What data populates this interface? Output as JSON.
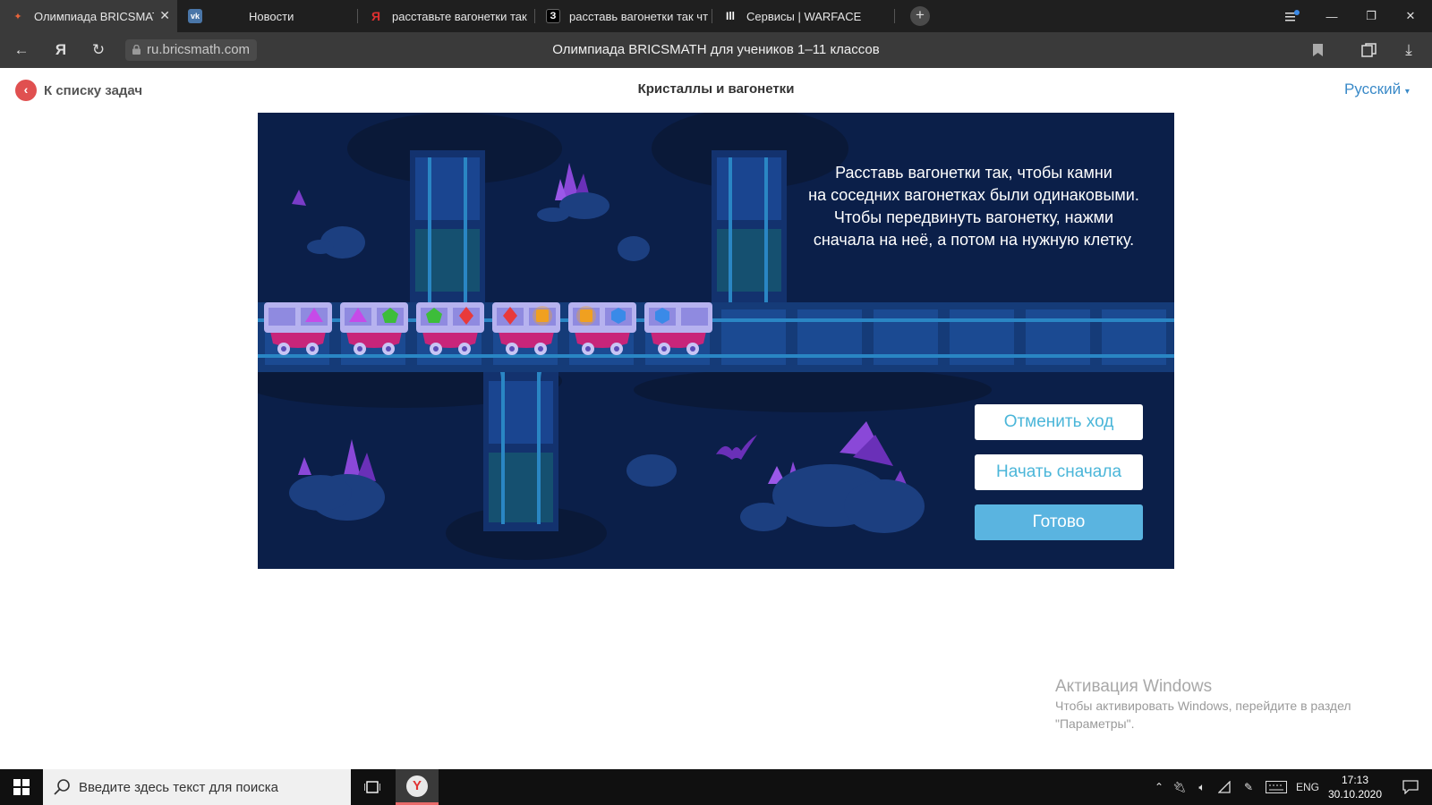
{
  "browser": {
    "tabs": [
      {
        "label": "Олимпиада BRICSMATH",
        "icon": "bricsmath-icon",
        "active": true
      },
      {
        "label": "Новости",
        "icon": "vk-icon",
        "active": false
      },
      {
        "label": "расставьте вагонетки так",
        "icon": "yandex-icon",
        "active": false
      },
      {
        "label": "расставь вагонетки так чт",
        "icon": "znanija-icon",
        "active": false
      },
      {
        "label": "Сервисы | WARFACE",
        "icon": "warface-icon",
        "active": false
      }
    ],
    "url": "ru.bricsmath.com",
    "page_title": "Олимпиада BRICSMATH для учеников 1–11 классов"
  },
  "header": {
    "back_label": "К списку задач",
    "task_title": "Кристаллы и вагонетки",
    "language": "Русский"
  },
  "game": {
    "instructions": [
      "Расставь вагонетки так, чтобы камни",
      "на соседних вагонетках были одинаковыми.",
      "Чтобы передвинуть вагонетку, нажми",
      "сначала на неё, а потом на нужную клетку."
    ],
    "carts": [
      {
        "left": "empty",
        "right": "purple-triangle"
      },
      {
        "left": "purple-triangle",
        "right": "green-pentagon"
      },
      {
        "left": "green-pentagon",
        "right": "red-diamond"
      },
      {
        "left": "red-diamond",
        "right": "orange-square"
      },
      {
        "left": "orange-square",
        "right": "blue-hexagon"
      },
      {
        "left": "blue-hexagon",
        "right": "empty"
      }
    ],
    "gem_colors": {
      "purple-triangle": "#c64be8",
      "green-pentagon": "#3dbd3a",
      "red-diamond": "#e83a3a",
      "orange-square": "#f0a020",
      "blue-hexagon": "#3a8ae8"
    },
    "buttons": {
      "undo": "Отменить ход",
      "restart": "Начать сначала",
      "done": "Готово"
    }
  },
  "watermark": {
    "title": "Активация Windows",
    "line1": "Чтобы активировать Windows, перейдите в раздел",
    "line2": "\"Параметры\"."
  },
  "taskbar": {
    "search_placeholder": "Введите здесь текст для поиска",
    "lang": "ENG",
    "time": "17:13",
    "date": "30.10.2020"
  }
}
